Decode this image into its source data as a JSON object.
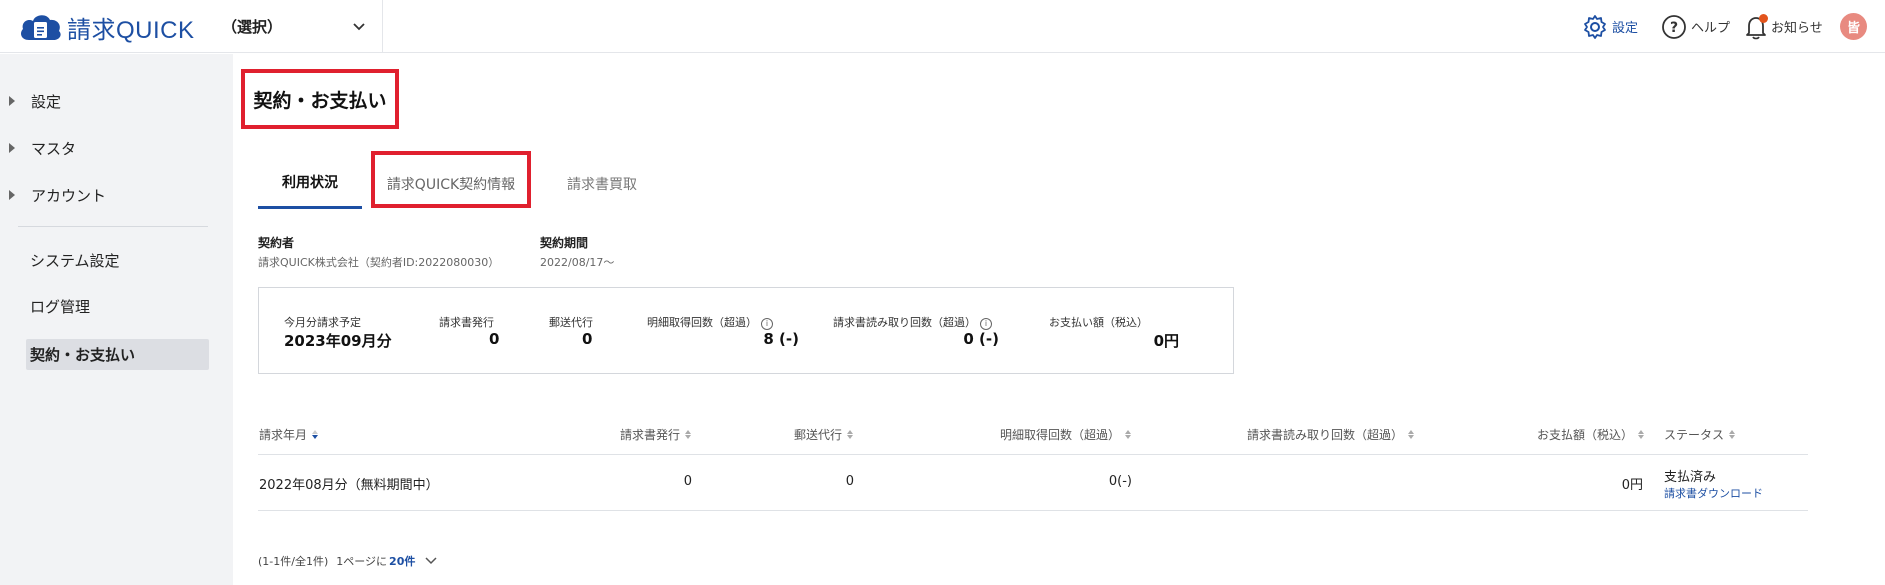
{
  "app": {
    "logo_text": "請求QUICK",
    "company_select": "（選択）"
  },
  "header": {
    "settings": "設定",
    "help": "ヘルプ",
    "news": "お知らせ",
    "avatar": "皆"
  },
  "sidebar": {
    "groups": [
      {
        "label": "設定"
      },
      {
        "label": "マスタ"
      },
      {
        "label": "アカウント"
      }
    ],
    "links": [
      {
        "label": "システム設定"
      },
      {
        "label": "ログ管理"
      },
      {
        "label": "契約・お支払い",
        "active": true
      }
    ]
  },
  "page": {
    "title": "契約・お支払い",
    "tabs": [
      {
        "label": "利用状況",
        "active": true
      },
      {
        "label": "請求QUICK契約情報"
      },
      {
        "label": "請求書買取"
      }
    ]
  },
  "contract": {
    "holder_label": "契約者",
    "holder_value": "請求QUICK株式会社（契約者ID:2022080030）",
    "period_label": "契約期間",
    "period_value": "2022/08/17〜"
  },
  "summary": {
    "billing_label": "今月分請求予定",
    "billing_value": "2023年09月分",
    "issue_label": "請求書発行",
    "issue_value": "0",
    "mail_label": "郵送代行",
    "mail_value": "0",
    "detail_label": "明細取得回数（超過）",
    "detail_value": "8 (-)",
    "read_label": "請求書読み取り回数（超過）",
    "read_value": "0 (-)",
    "pay_label": "お支払い額（税込）",
    "pay_value": "0円"
  },
  "table": {
    "headers": {
      "month": "請求年月",
      "issue": "請求書発行",
      "mail": "郵送代行",
      "detail": "明細取得回数（超過）",
      "read": "請求書読み取り回数（超過）",
      "amount": "お支払額（税込）",
      "status": "ステータス"
    },
    "rows": [
      {
        "month": "2022年08月分（無料期間中）",
        "issue": "0",
        "mail": "0",
        "detail": "0(-)",
        "read": "",
        "amount": "0円",
        "status": "支払済み",
        "download": "請求書ダウンロード"
      }
    ]
  },
  "pager": {
    "range": "(1-1件/全1件)",
    "per_page_label": "1ページに",
    "per_page_value": "20件"
  },
  "colors": {
    "brand": "#1d4fa3",
    "highlight": "#e0202e",
    "badge": "#e2541c",
    "avatar": "#e88a80"
  }
}
